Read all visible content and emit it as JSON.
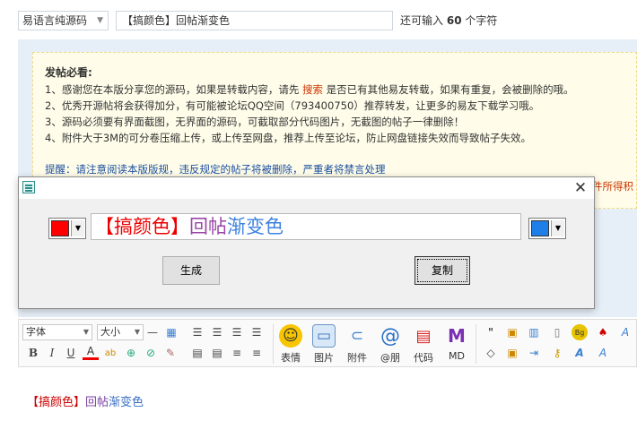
{
  "post": {
    "category": "易语言纯源码",
    "title": "【搞颜色】回帖渐变色",
    "remaining_prefix": "还可输入",
    "remaining_count": "60",
    "remaining_suffix": "个字符"
  },
  "notice": {
    "title": "发帖必看:",
    "line1_a": "1、感谢您在本版分享您的源码，如果是转载内容，请先",
    "line1_link": "搜索",
    "line1_b": "是否已有其他易友转载，如果有重复，会被删除的哦。",
    "line2": "2、优秀开源帖将会获得加分，有可能被论坛QQ空间（793400750）推荐转发，让更多的易友下载学习哦。",
    "line3": "3、源码必须要有界面截图，无界面的源码，可截取部分代码图片，无截图的帖子一律删除！",
    "line4": "4、附件大于3M的可分卷压缩上传，或上传至网盘，推荐上传至论坛，防止网盘链接失效而导致帖子失效。",
    "tip": "提醒：请注意阅读本版版规，违反规定的帖子将被删除，严重者将禁言处理",
    "tip_extra": "件所得积"
  },
  "toolbar": {
    "font_label": "字体",
    "size_label": "大小",
    "emoji": "表情",
    "image": "图片",
    "attachment": "附件",
    "mention": "@朋",
    "code": "代码",
    "md": "MD"
  },
  "editor": {
    "part_red": "【搞颜色】",
    "part_purple": "回帖",
    "part_blue": "渐变色"
  },
  "dialog": {
    "preview_red": "【搞颜色】",
    "preview_purple": "回帖",
    "preview_blue": "渐变色",
    "start_color": "#ff0000",
    "end_color": "#1e7fe8",
    "generate_label": "生成",
    "copy_label": "复制"
  }
}
